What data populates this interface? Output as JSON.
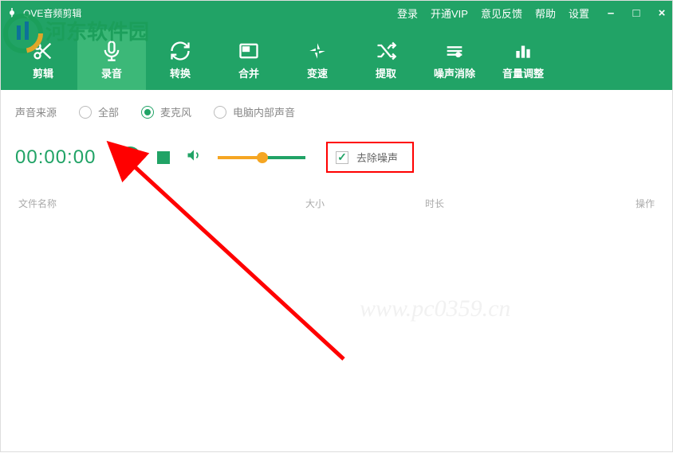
{
  "app": {
    "title": "QVE音频剪辑"
  },
  "title_links": {
    "login": "登录",
    "vip": "开通VIP",
    "feedback": "意见反馈",
    "help": "帮助",
    "settings": "设置"
  },
  "toolbar": {
    "cut": "剪辑",
    "record": "录音",
    "convert": "转换",
    "merge": "合并",
    "speed": "变速",
    "extract": "提取",
    "denoise": "噪声消除",
    "volume": "音量调整"
  },
  "source": {
    "label": "声音来源",
    "opt_all": "全部",
    "opt_mic": "麦克风",
    "opt_sys": "电脑内部声音"
  },
  "recorder": {
    "timer": "00:00:00",
    "noise_label": "去除噪声"
  },
  "table": {
    "col_name": "文件名称",
    "col_size": "大小",
    "col_dur": "时长",
    "col_op": "操作"
  },
  "watermark": {
    "logo_text": "河东软件园",
    "url": "www.pc0359.cn"
  }
}
